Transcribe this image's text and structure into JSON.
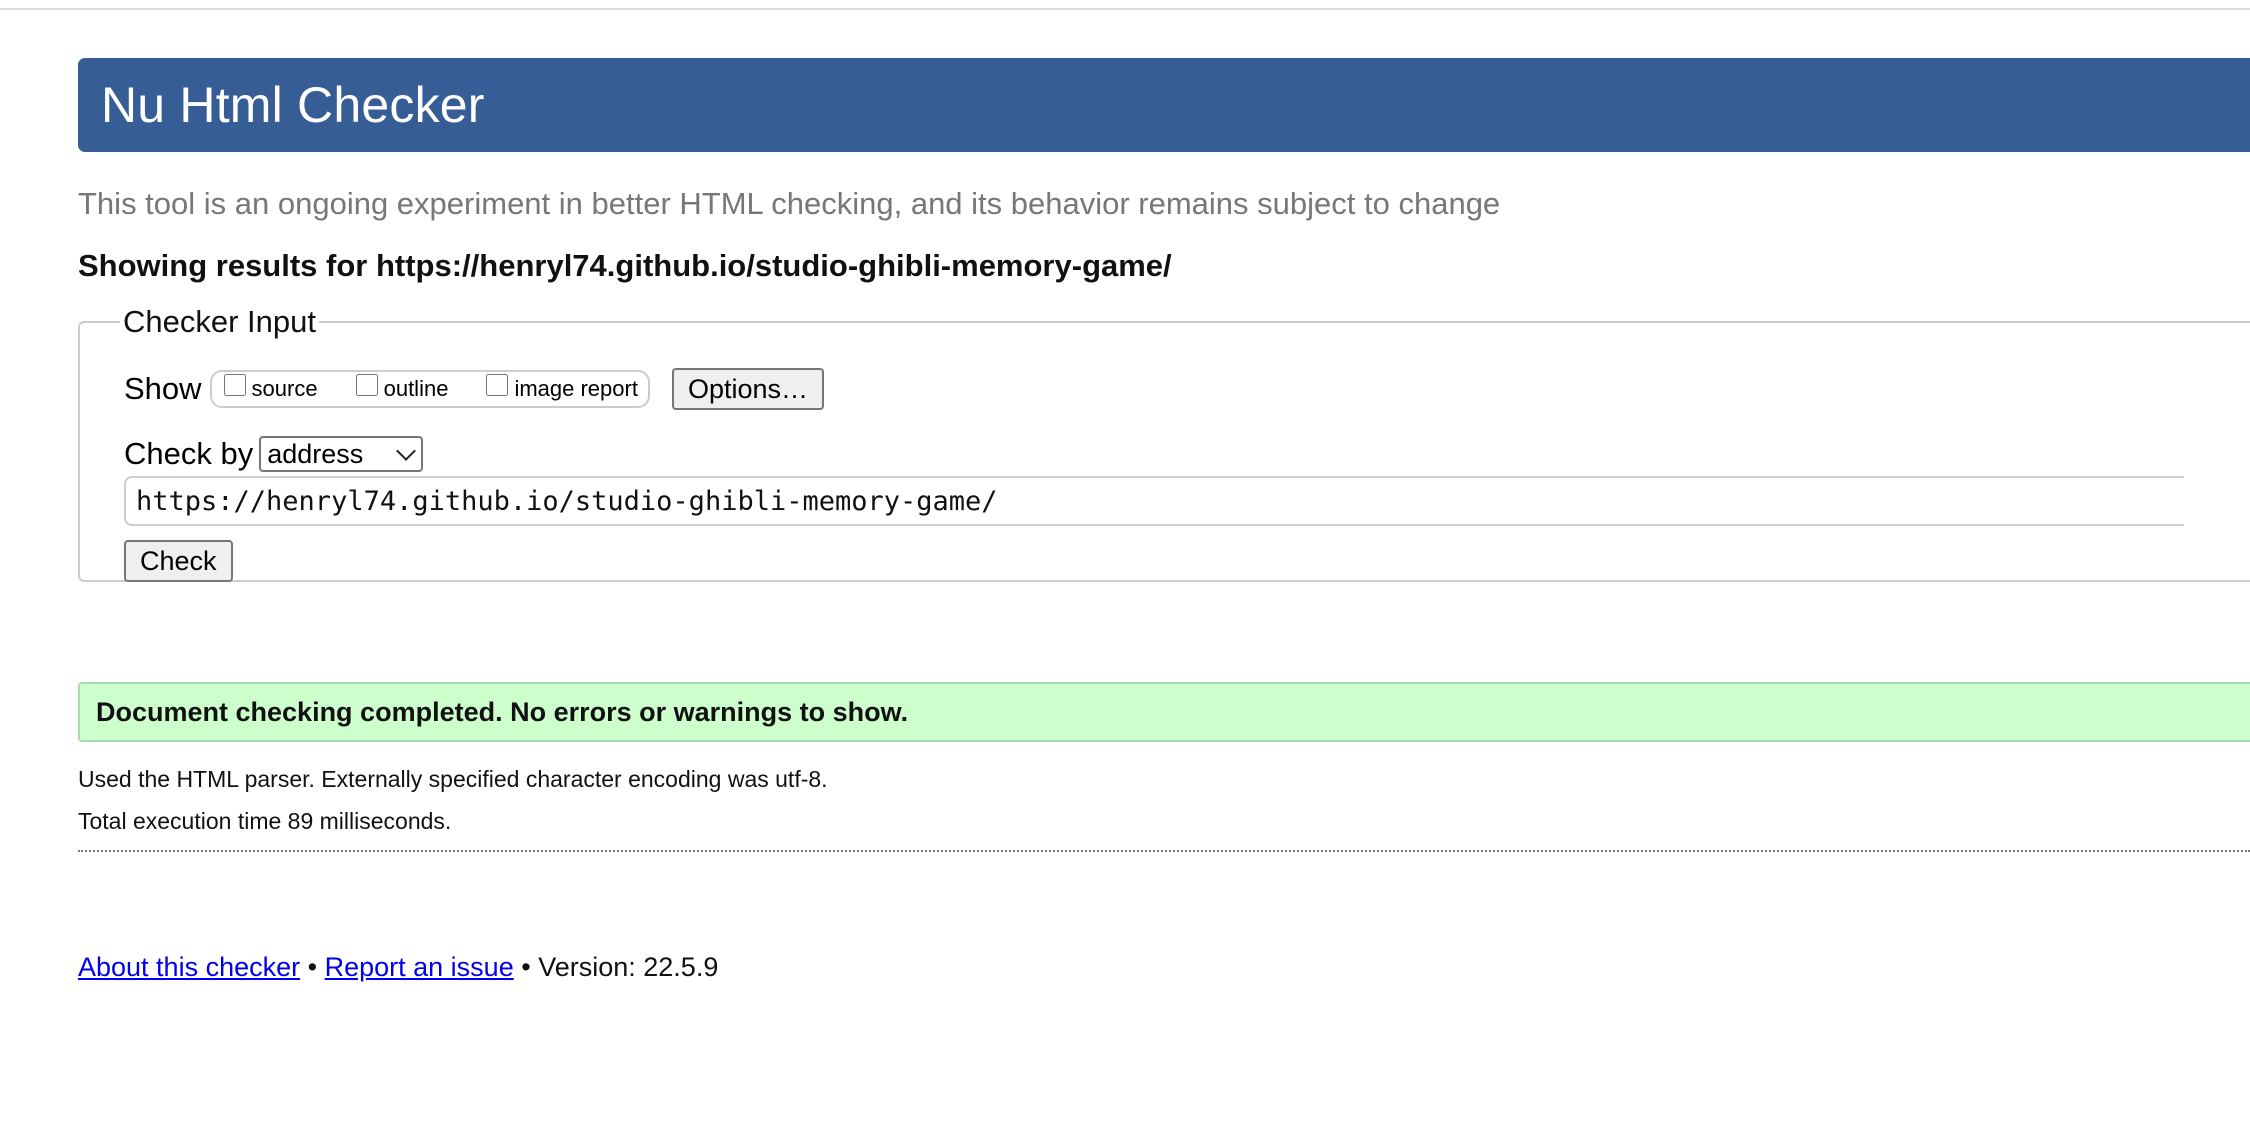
{
  "header": {
    "title": "Nu Html Checker"
  },
  "tagline": "This tool is an ongoing experiment in better HTML checking, and its behavior remains subject to change",
  "results_heading": "Showing results for https://henryl74.github.io/studio-ghibli-memory-game/",
  "checker_input": {
    "legend": "Checker Input",
    "show_label": "Show",
    "show_options": [
      {
        "label": "source",
        "checked": false
      },
      {
        "label": "outline",
        "checked": false
      },
      {
        "label": "image report",
        "checked": false
      }
    ],
    "options_button": "Options…",
    "check_by_label": "Check by",
    "check_by_selected": "address",
    "url_value": "https://henryl74.github.io/studio-ghibli-memory-game/",
    "check_button": "Check"
  },
  "result": {
    "message": "Document checking completed. No errors or warnings to show.",
    "parser_info": "Used the HTML parser. Externally specified character encoding was utf-8.",
    "execution_time": "Total execution time 89 milliseconds."
  },
  "footer": {
    "about_link": "About this checker",
    "separator": "•",
    "report_link": "Report an issue",
    "version": "Version: 22.5.9"
  },
  "colors": {
    "header_bg": "#365d95",
    "success_bg": "#ccffcc",
    "link": "#0000ee"
  }
}
